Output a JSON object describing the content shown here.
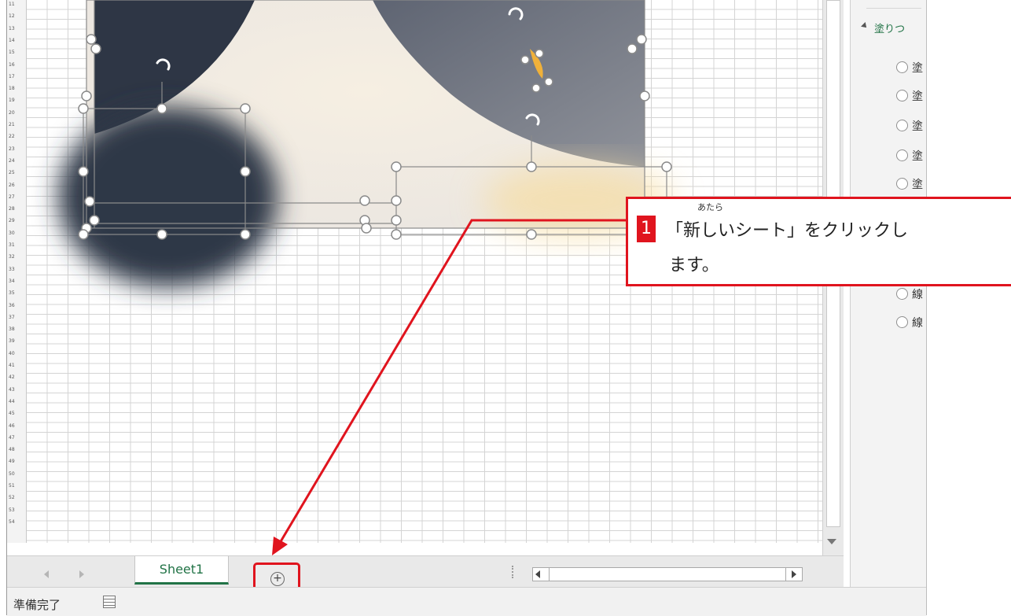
{
  "row_numbers": [
    "11",
    "12",
    "13",
    "14",
    "15",
    "16",
    "17",
    "18",
    "19",
    "20",
    "21",
    "22",
    "23",
    "24",
    "25",
    "26",
    "27",
    "28",
    "29",
    "30",
    "31",
    "32",
    "33",
    "34",
    "35",
    "36",
    "37",
    "38",
    "39",
    "40",
    "41",
    "42",
    "43",
    "44",
    "45",
    "46",
    "47",
    "48",
    "49",
    "50",
    "51",
    "52",
    "53",
    "54"
  ],
  "format_pane": {
    "section_title": "塗りつ",
    "options": [
      "塗",
      "塗",
      "塗",
      "塗",
      "塗",
      "線",
      "線"
    ]
  },
  "sheet_tabs": [
    {
      "label": "Sheet1"
    }
  ],
  "add_sheet_symbol": "+",
  "status": {
    "text": "準備完了"
  },
  "callout": {
    "number": "1",
    "ruby": "あたら",
    "line1": "「新しいシート」をクリックし",
    "line2": "ます。",
    "accent_color": "#e0141e"
  }
}
